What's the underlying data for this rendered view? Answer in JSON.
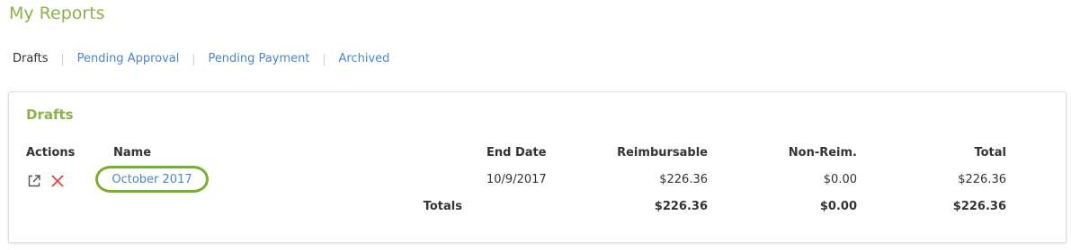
{
  "page": {
    "title": "My Reports"
  },
  "tabs": [
    {
      "label": "Drafts",
      "active": true
    },
    {
      "label": "Pending Approval",
      "active": false
    },
    {
      "label": "Pending Payment",
      "active": false
    },
    {
      "label": "Archived",
      "active": false
    }
  ],
  "drafts": {
    "title": "Drafts",
    "columns": {
      "actions": "Actions",
      "name": "Name",
      "end_date": "End Date",
      "reimbursable": "Reimbursable",
      "non_reim": "Non-Reim.",
      "total": "Total"
    },
    "rows": [
      {
        "name": "October 2017",
        "end_date": "10/9/2017",
        "reimbursable": "$226.36",
        "non_reim": "$0.00",
        "total": "$226.36",
        "actions": [
          "open-external-icon",
          "delete-x-icon"
        ]
      }
    ],
    "totals": {
      "label": "Totals",
      "reimbursable": "$226.36",
      "non_reim": "$0.00",
      "total": "$226.36"
    }
  },
  "colors": {
    "accent_green": "#8db04a",
    "highlight_ring": "#7aae2a",
    "link_blue": "#4a86c5",
    "delete_red": "#e0413f"
  }
}
